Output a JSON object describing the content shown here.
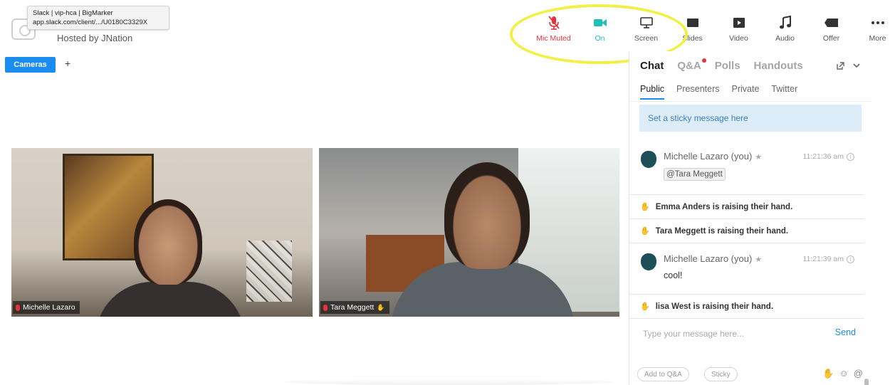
{
  "tooltip": {
    "line1": "Slack | vip-hca | BigMarker",
    "line2": "app.slack.com/client/.../U0180C3329X"
  },
  "header": {
    "host": "Hosted by JNation"
  },
  "toolbar": {
    "items": [
      {
        "label": "Mic Muted",
        "icon": "mic-muted-icon",
        "color": "#e8333e"
      },
      {
        "label": "On",
        "icon": "camera-icon",
        "color": "#21c0b6"
      },
      {
        "label": "Screen",
        "icon": "screen-share-icon"
      },
      {
        "label": "Slides",
        "icon": "slides-icon"
      },
      {
        "label": "Video",
        "icon": "video-play-icon"
      },
      {
        "label": "Audio",
        "icon": "music-note-icon"
      },
      {
        "label": "Offer",
        "icon": "tag-icon"
      },
      {
        "label": "More",
        "icon": "ellipsis-icon"
      }
    ]
  },
  "stage": {
    "tab_label": "Cameras",
    "add_label": "+",
    "videos": [
      {
        "name": "Michelle Lazaro"
      },
      {
        "name": "Tara Meggett"
      }
    ]
  },
  "panel": {
    "tabs": [
      "Chat",
      "Q&A",
      "Polls",
      "Handouts"
    ],
    "sub_tabs": [
      "Public",
      "Presenters",
      "Private",
      "Twitter"
    ],
    "sticky": "Set a sticky message here",
    "messages": [
      {
        "author": "Michelle Lazaro (you)",
        "time": "11:21:36 am",
        "mention": "@Tara Meggett"
      },
      {
        "author": "Michelle Lazaro (you)",
        "time": "11:21:39 am",
        "body": "cool!"
      }
    ],
    "events": [
      "Emma Anders is raising their hand.",
      "Tara Meggett is raising their hand.",
      "lisa West is raising their hand."
    ],
    "compose_placeholder": "Type your message here...",
    "send_label": "Send",
    "bottom_buttons": [
      "Add to Q&A",
      "Sticky"
    ]
  },
  "colors": {
    "accent": "#1a8cf0",
    "muted": "#e8333e",
    "camera_on": "#21c0b6",
    "highlight": "#f2ef48"
  }
}
